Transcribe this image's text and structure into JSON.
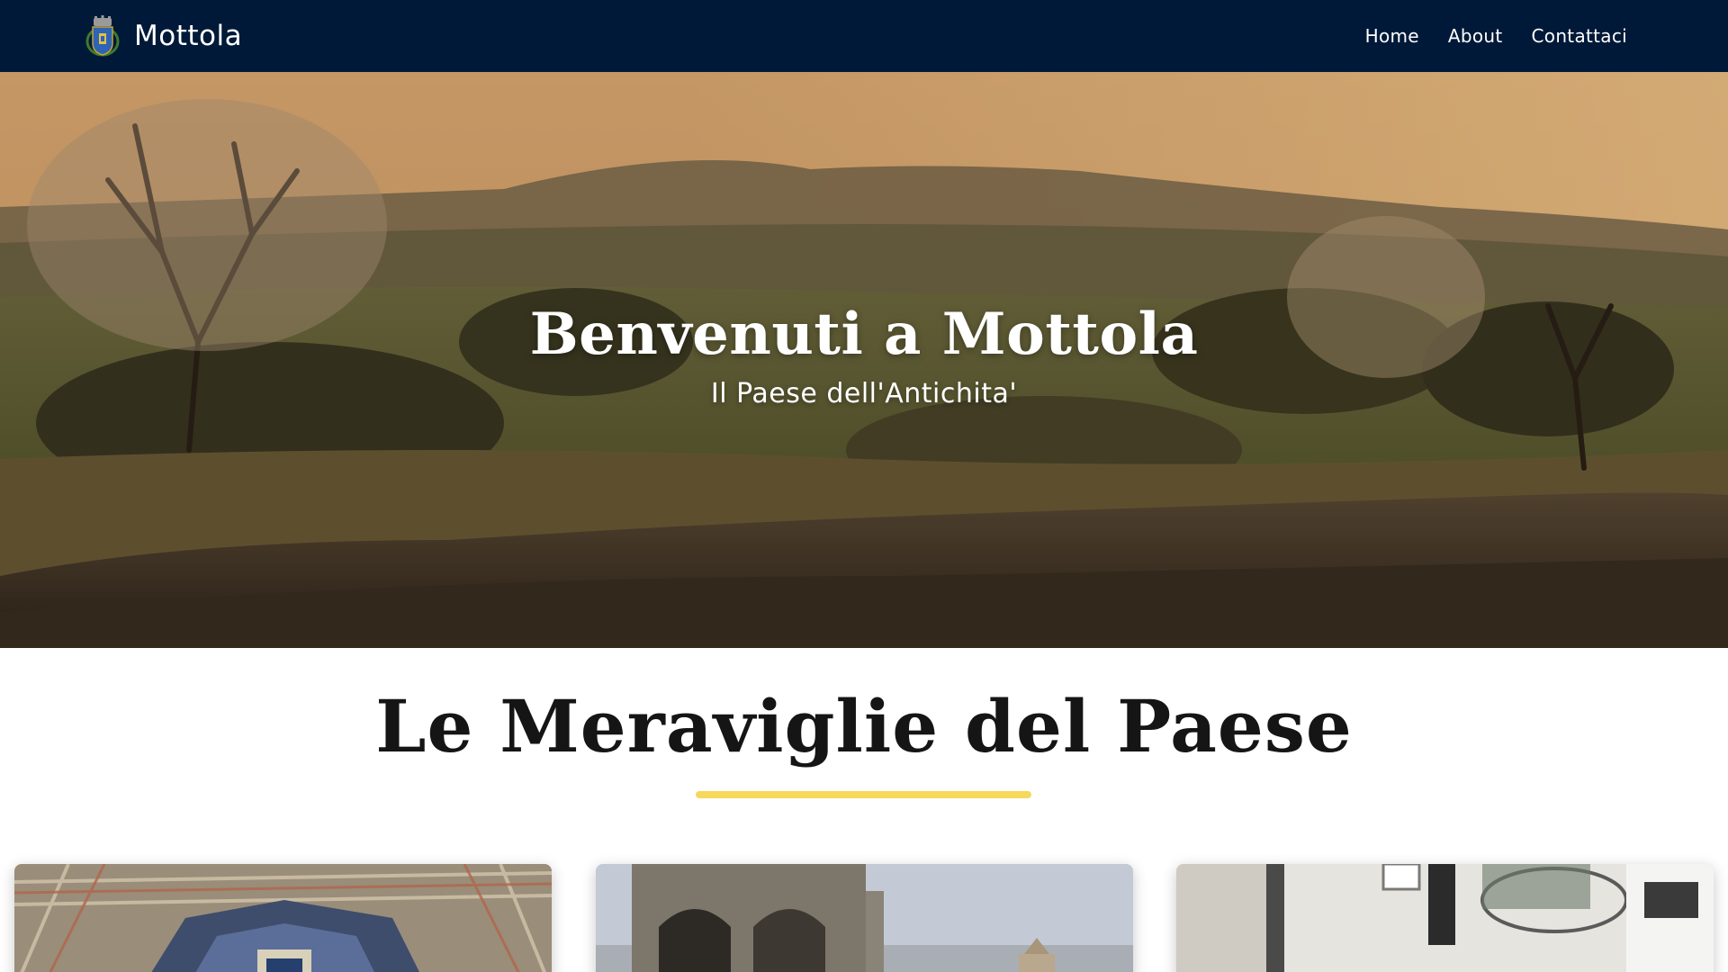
{
  "navbar": {
    "brand_name": "Mottola",
    "logo_icon": "coat-of-arms-icon",
    "background": "#001938",
    "links": [
      {
        "label": "Home"
      },
      {
        "label": "About"
      },
      {
        "label": "Contattaci"
      }
    ]
  },
  "hero": {
    "title": "Benvenuti a Mottola",
    "subtitle": "Il Paese dell'Antichita'"
  },
  "section": {
    "title": "Le Meraviglie del Paese",
    "underline_color": "#f5d85c"
  },
  "cards": [
    {
      "image": "mosaic-pavement-photo"
    },
    {
      "image": "stone-arch-church-photo"
    },
    {
      "image": "whitewashed-alley-photo"
    }
  ]
}
